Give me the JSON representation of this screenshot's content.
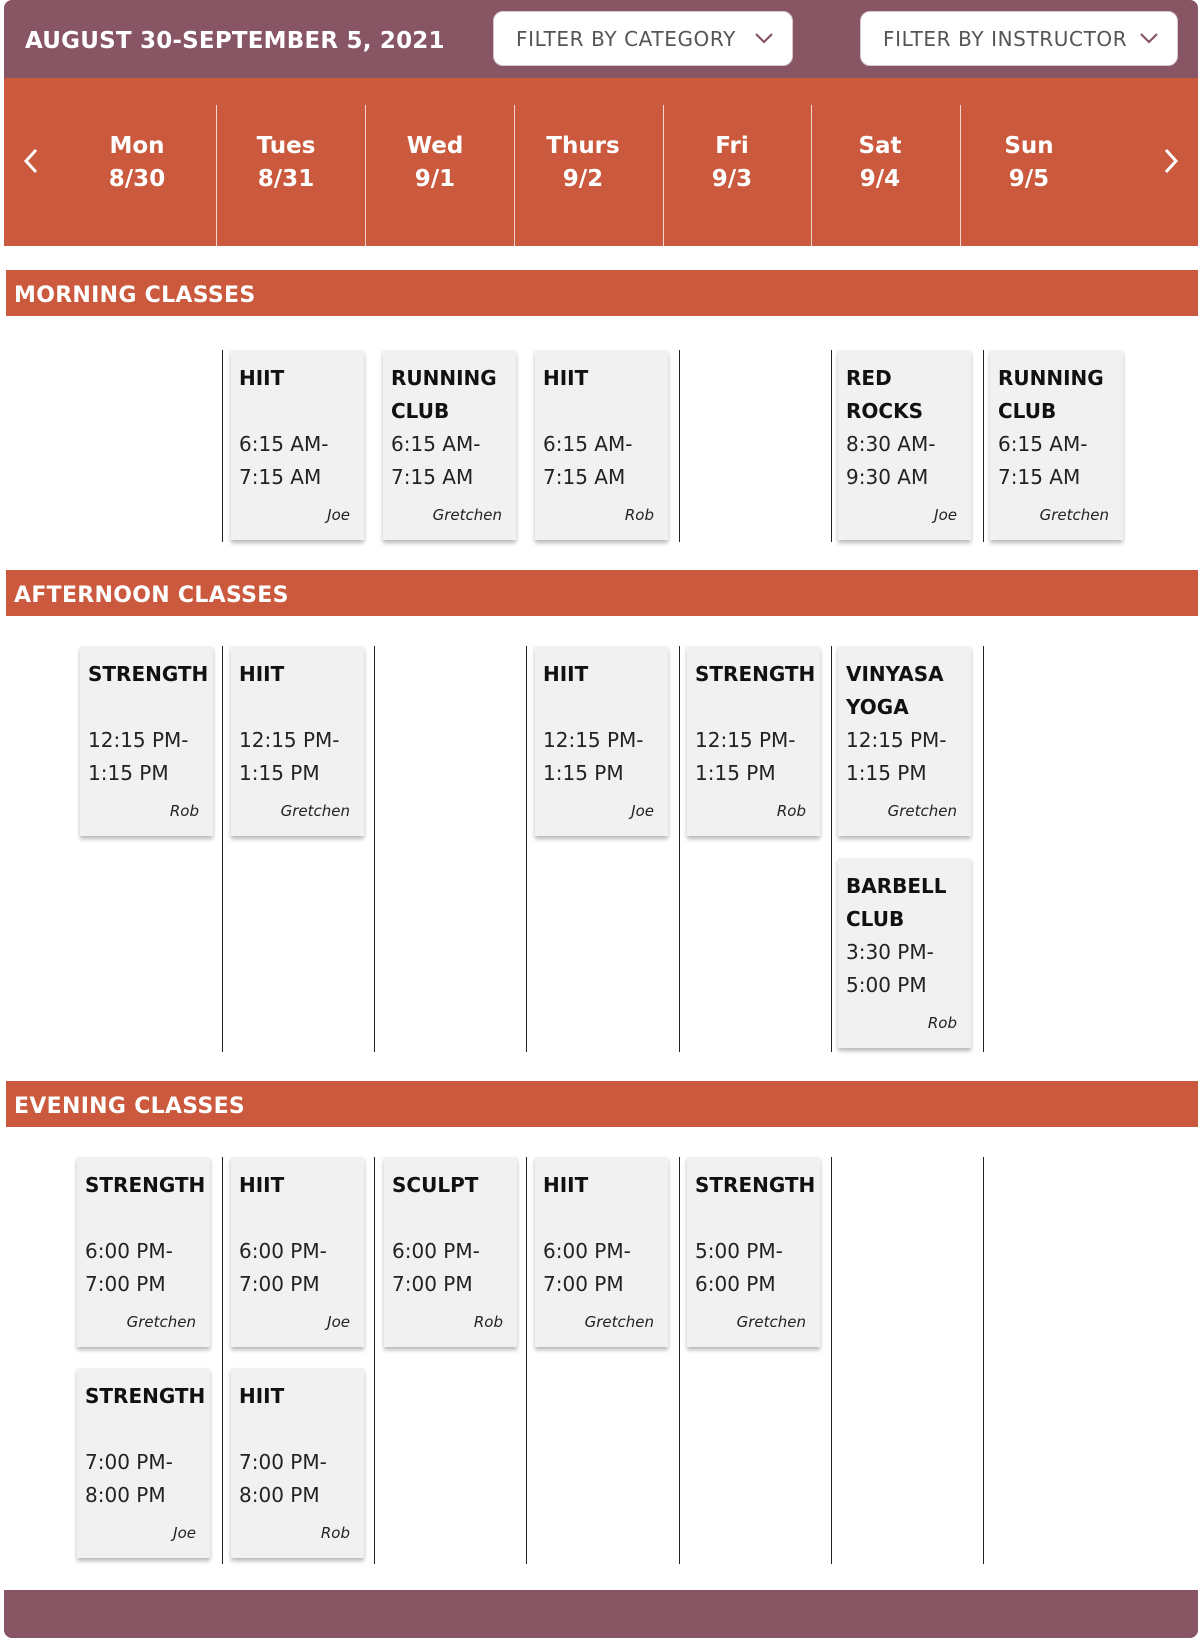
{
  "header": {
    "week_range": "AUGUST 30-SEPTEMBER 5, 2021",
    "filter_category": "FILTER BY CATEGORY",
    "filter_instructor": "FILTER BY INSTRUCTOR"
  },
  "days": [
    {
      "name": "Mon",
      "date": "8/30"
    },
    {
      "name": "Tues",
      "date": "8/31"
    },
    {
      "name": "Wed",
      "date": "9/1"
    },
    {
      "name": "Thurs",
      "date": "9/2"
    },
    {
      "name": "Fri",
      "date": "9/3"
    },
    {
      "name": "Sat",
      "date": "9/4"
    },
    {
      "name": "Sun",
      "date": "9/5"
    }
  ],
  "sections": {
    "morning": {
      "label": "MORNING CLASSES",
      "classes": [
        {
          "title": "HIIT",
          "time_start": "6:15 AM-",
          "time_end": "7:15 AM",
          "instructor": "Joe"
        },
        {
          "title": "RUNNING CLUB",
          "time_start": "6:15 AM-",
          "time_end": "7:15 AM",
          "instructor": "Gretchen"
        },
        {
          "title": "HIIT",
          "time_start": "6:15 AM-",
          "time_end": "7:15 AM",
          "instructor": "Rob"
        },
        {
          "title": "RED ROCKS",
          "time_start": "8:30 AM-",
          "time_end": "9:30 AM",
          "instructor": "Joe"
        },
        {
          "title": "RUNNING CLUB",
          "time_start": "6:15 AM-",
          "time_end": "7:15 AM",
          "instructor": "Gretchen"
        }
      ]
    },
    "afternoon": {
      "label": "AFTERNOON CLASSES",
      "classes": [
        {
          "title": "STRENGTH",
          "time_start": "12:15 PM-",
          "time_end": "1:15 PM",
          "instructor": "Rob"
        },
        {
          "title": "HIIT",
          "time_start": "12:15 PM-",
          "time_end": "1:15 PM",
          "instructor": "Gretchen"
        },
        {
          "title": "HIIT",
          "time_start": "12:15 PM-",
          "time_end": "1:15 PM",
          "instructor": "Joe"
        },
        {
          "title": "STRENGTH",
          "time_start": "12:15 PM-",
          "time_end": "1:15 PM",
          "instructor": "Rob"
        },
        {
          "title": "VINYASA YOGA",
          "time_start": "12:15 PM-",
          "time_end": "1:15 PM",
          "instructor": "Gretchen"
        },
        {
          "title": "BARBELL CLUB",
          "time_start": "3:30 PM-",
          "time_end": "5:00 PM",
          "instructor": "Rob"
        }
      ]
    },
    "evening": {
      "label": "EVENING CLASSES",
      "classes": [
        {
          "title": "STRENGTH",
          "time_start": "6:00 PM-",
          "time_end": "7:00 PM",
          "instructor": "Gretchen"
        },
        {
          "title": "HIIT",
          "time_start": "6:00 PM-",
          "time_end": "7:00 PM",
          "instructor": "Joe"
        },
        {
          "title": "SCULPT",
          "time_start": "6:00 PM-",
          "time_end": "7:00 PM",
          "instructor": "Rob"
        },
        {
          "title": "HIIT",
          "time_start": "6:00 PM-",
          "time_end": "7:00 PM",
          "instructor": "Gretchen"
        },
        {
          "title": "STRENGTH",
          "time_start": "5:00 PM-",
          "time_end": "6:00 PM",
          "instructor": "Gretchen"
        },
        {
          "title": "STRENGTH",
          "time_start": "7:00 PM-",
          "time_end": "8:00 PM",
          "instructor": "Joe"
        },
        {
          "title": "HIIT",
          "time_start": "7:00 PM-",
          "time_end": "8:00 PM",
          "instructor": "Rob"
        }
      ]
    }
  },
  "icons": {
    "prev": "chevron-left-icon",
    "next": "chevron-right-icon",
    "dropdown": "chevron-down-icon"
  },
  "colors": {
    "header_bg": "#875563",
    "accent": "#cb593d",
    "card_bg": "#f1f1f1"
  }
}
